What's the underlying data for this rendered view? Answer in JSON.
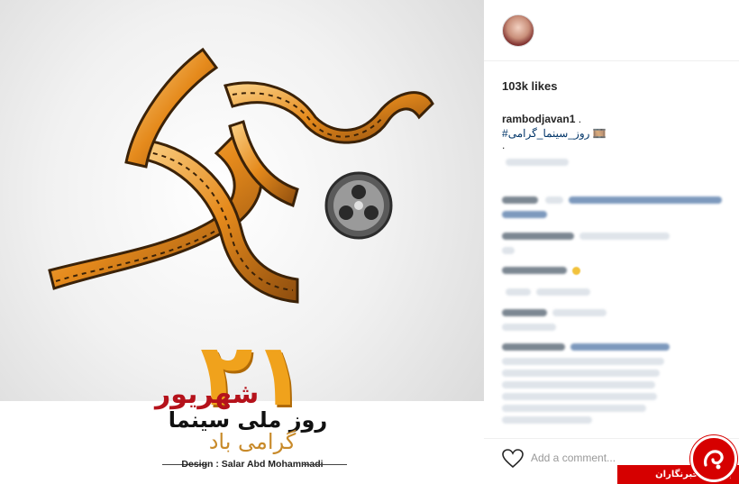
{
  "post": {
    "poster": {
      "big_number": "۲۱",
      "month": "شهریور",
      "line1": "روز ملی سینما",
      "line2": "گرامی باد",
      "credit": "Design : Salar Abd Mohammadi"
    }
  },
  "sidebar": {
    "likes": "103k likes",
    "caption": {
      "username": "rambodjavan1",
      "separator": " .",
      "hashtag": "#روز_سینما_گرامی 🎞️",
      "dot": "."
    },
    "comment_placeholder": "Add a comment..."
  },
  "watermark": {
    "label": "باشگاه خبرنگاران"
  },
  "colors": {
    "film_orange": "#f0a21c",
    "film_dark": "#7a4a14",
    "month_red": "#b5121b",
    "hashtag_blue": "#003569",
    "watermark_red": "#d60000"
  }
}
